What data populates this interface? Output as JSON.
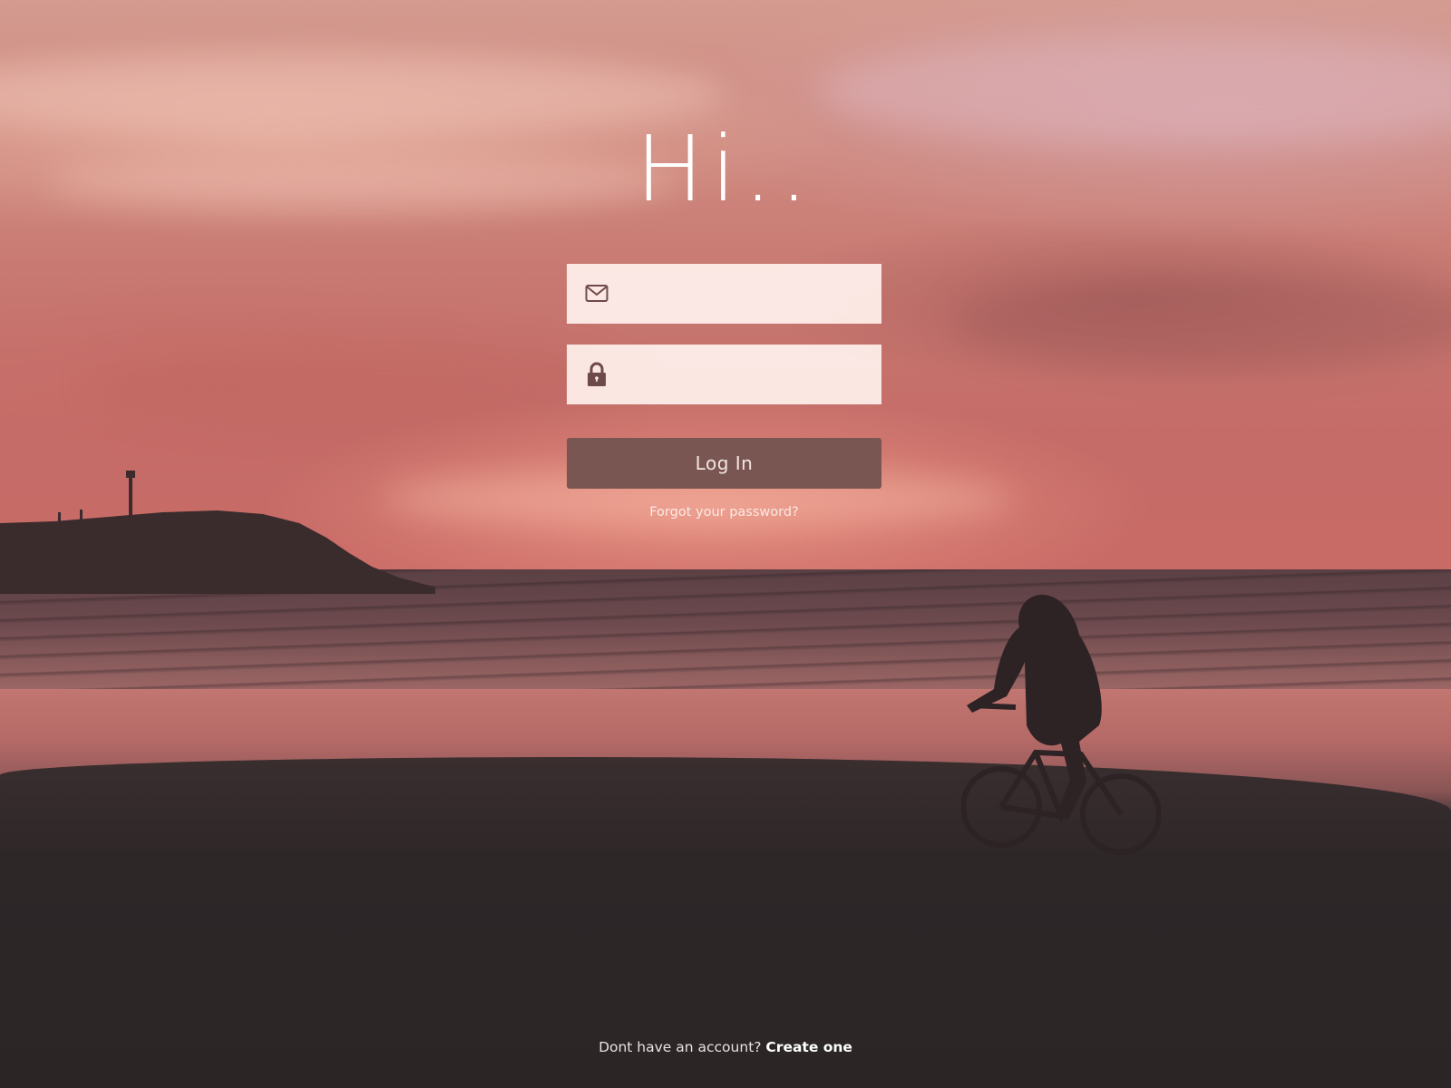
{
  "greeting": "Hi..",
  "login_form": {
    "email": {
      "value": "",
      "placeholder": "",
      "icon": "envelope-icon"
    },
    "password": {
      "value": "",
      "placeholder": "",
      "icon": "lock-icon"
    },
    "submit_label": "Log In",
    "forgot_link": "Forgot your password?"
  },
  "signup": {
    "prompt": "Dont have an account?",
    "link_label": "Create one"
  },
  "colors": {
    "button": "#7a5652",
    "field_background": "#fff0ec",
    "icon": "#6e4a4a",
    "text_light": "#ffffff"
  }
}
